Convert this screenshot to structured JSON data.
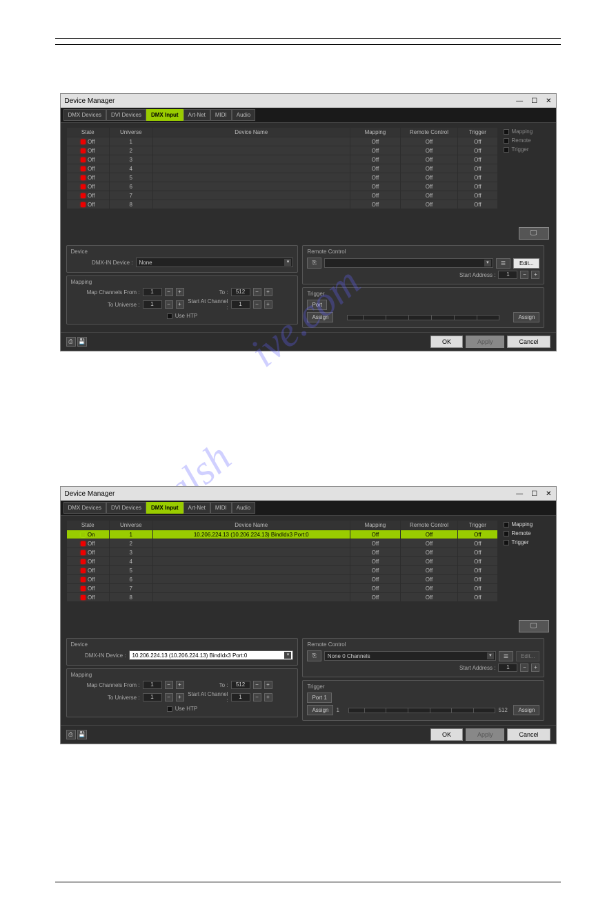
{
  "window_title": "Device Manager",
  "win_controls": {
    "min": "—",
    "max": "☐",
    "close": "✕"
  },
  "tabs": {
    "t0": "DMX Devices",
    "t1": "DVI Devices",
    "t2": "DMX Input",
    "t3": "Art-Net",
    "t4": "MIDI",
    "t5": "Audio"
  },
  "headers": {
    "state": "State",
    "universe": "Universe",
    "device_name": "Device Name",
    "mapping": "Mapping",
    "remote": "Remote Control",
    "trigger": "Trigger"
  },
  "side": {
    "mapping": "Mapping",
    "remote": "Remote",
    "trigger": "Trigger"
  },
  "off": "Off",
  "on": "On",
  "universes": [
    "1",
    "2",
    "3",
    "4",
    "5",
    "6",
    "7",
    "8"
  ],
  "device_panel": {
    "title": "Device",
    "label": "DMX-IN Device :",
    "none": "None",
    "sel": "10.206.224.13 (10.206.224.13) BindIdx3 Port:0"
  },
  "mapping_panel": {
    "title": "Mapping",
    "from": "Map Channels From :",
    "to_lbl": "To :",
    "to_univ": "To Universe :",
    "start": "Start At Channel :",
    "htp": "Use HTP",
    "v1": "1",
    "v512": "512"
  },
  "remote_panel": {
    "title": "Remote Control",
    "start_addr": "Start Address :",
    "edit": "Edit...",
    "v1": "1",
    "none": "None  0 Channels"
  },
  "trigger_panel": {
    "title": "Trigger",
    "port": "Port",
    "port1": "Port 1",
    "assign": "Assign",
    "v1": "1",
    "v512": "512"
  },
  "footer": {
    "ok": "OK",
    "apply": "Apply",
    "cancel": "Cancel"
  },
  "row_device": "10.206.224.13 (10.206.224.13) BindIdx3 Port:0",
  "monitor_icon": "⌨"
}
